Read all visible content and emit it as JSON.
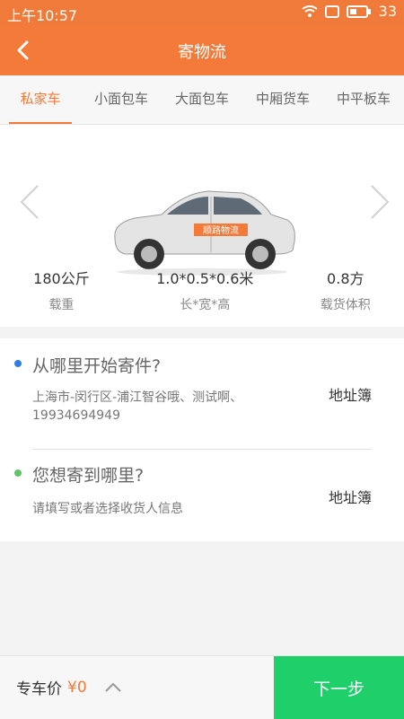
{
  "status_bar": {
    "time": "上午10:57",
    "battery": "33"
  },
  "header": {
    "title": "寄物流"
  },
  "tabs": [
    {
      "label": "私家车"
    },
    {
      "label": "小面包车"
    },
    {
      "label": "大面包车"
    },
    {
      "label": "中厢货车"
    },
    {
      "label": "中平板车"
    }
  ],
  "vehicle": {
    "car_badge": "顺路物流",
    "specs": [
      {
        "value": "180公斤",
        "label": "载重"
      },
      {
        "value": "1.0*0.5*0.6米",
        "label": "长*宽*高"
      },
      {
        "value": "0.8方",
        "label": "载货体积"
      }
    ]
  },
  "address": {
    "from": {
      "question": "从哪里开始寄件?",
      "detail_line1": "上海市-闵行区-浦江智谷哦、测试啊、",
      "detail_line2": "19934694949",
      "book": "地址簿"
    },
    "to": {
      "question": "您想寄到哪里?",
      "detail": "请填写或者选择收货人信息",
      "book": "地址簿"
    }
  },
  "footer": {
    "price_label": "专车价",
    "price_value": "¥0",
    "next": "下一步"
  },
  "colors": {
    "accent": "#f47a3a",
    "green": "#1fcf6a",
    "from_dot": "#2f7ee6",
    "to_dot": "#62c26a"
  }
}
